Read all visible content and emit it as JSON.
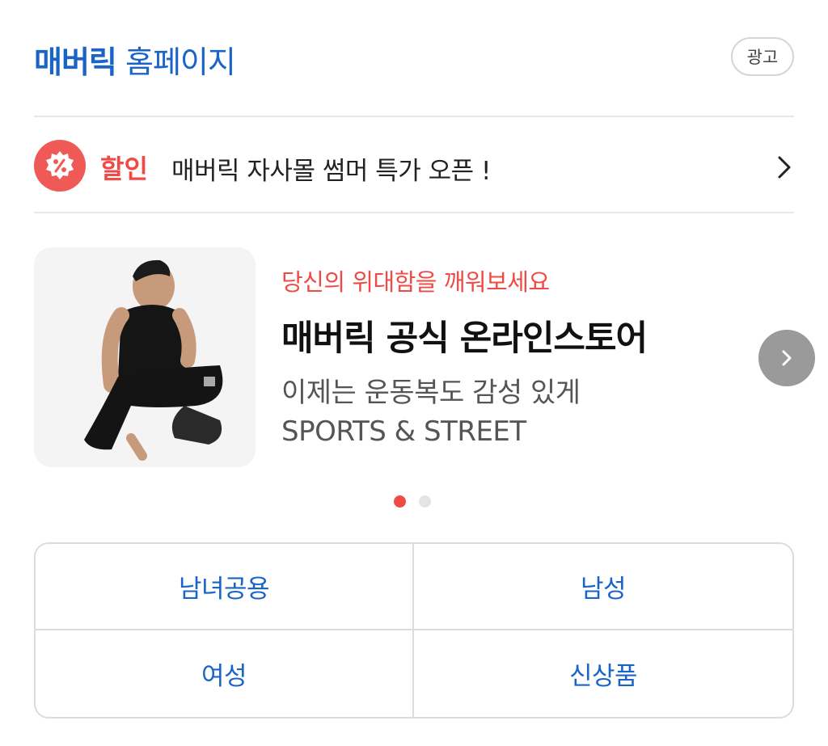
{
  "header": {
    "brand_strong": "매버릭",
    "brand_rest": "홈페이지",
    "ad_label": "광고"
  },
  "promo": {
    "icon": "discount-badge-icon",
    "tag": "할인",
    "text": "매버릭 자사몰 썸머 특가 오픈 !",
    "chevron": "chevron-right-icon"
  },
  "banner": {
    "eyebrow": "당신의 위대함을 깨워보세요",
    "title": "매버릭 공식 온라인스토어",
    "subtitle_line1": "이제는 운동복도 감성 있게",
    "subtitle_line2": "SPORTS & STREET",
    "next_icon": "chevron-right-icon",
    "pagination": {
      "current": 1,
      "total": 2
    }
  },
  "categories": [
    {
      "label": "남녀공용"
    },
    {
      "label": "남성"
    },
    {
      "label": "여성"
    },
    {
      "label": "신상품"
    }
  ],
  "colors": {
    "brand_blue": "#1a64c8",
    "accent_red": "#f04a45",
    "icon_red": "#f05a56",
    "next_button_gray": "#9a9a9a"
  }
}
